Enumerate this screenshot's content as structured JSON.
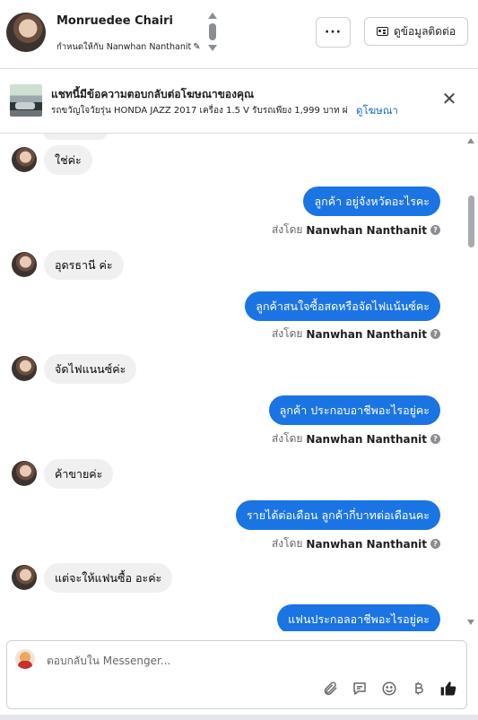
{
  "header": {
    "name": "Monruedee Chairi",
    "assigned_label": "กำหนดให้กับ Nanwhan Nanthanit",
    "more_label": "···",
    "contact_button": "ดูข้อมูลติดต่อ"
  },
  "ad_banner": {
    "title": "แชทนี้มีข้อความตอบกลับต่อโฆษณาของคุณ",
    "subtitle": "รถขวัญใจวัยรุ่น HONDA JAZZ 2017 เครื่อง 1.5 V รับรถเพียง 1,999 บาท ผ่...",
    "link": "ดูโฆษณา",
    "close": "✕"
  },
  "conversation": {
    "sent_by_prefix": "ส่งโดย",
    "agent_name": "Nanwhan Nanthanit",
    "messages": [
      {
        "dir": "in",
        "text": "ใช่ค่ะ"
      },
      {
        "dir": "out",
        "text": "ลูกค้า อยู่จังหวัดอะไรคะ"
      },
      {
        "dir": "in",
        "text": "อุดรธานี ค่ะ"
      },
      {
        "dir": "out",
        "text": "ลูกค้าสนใจซื้อสดหรือจัดไฟแน้นซ์คะ"
      },
      {
        "dir": "in",
        "text": "จัดไฟแนนซ์ค่ะ"
      },
      {
        "dir": "out",
        "text": "ลูกค้า ประกอบอาชีพอะไรอยู่คะ"
      },
      {
        "dir": "in",
        "text": "ค้าขายค่ะ"
      },
      {
        "dir": "out",
        "text": "รายได้ต่อเดือน ลูกค้ากี่บาทต่อเดือนคะ"
      },
      {
        "dir": "in",
        "text": "แต่จะให้แฟนซื้อ อะค่ะ"
      },
      {
        "dir": "out",
        "text": "แฟนประกอลอาชีพอะไรอยู่คะ"
      }
    ]
  },
  "composer": {
    "placeholder": "ตอบกลับใน Messenger..."
  },
  "icons": {
    "attach": "paperclip-icon",
    "saved_replies": "chat-bubble-icon",
    "emoji": "smiley-icon",
    "currency": "baht-icon",
    "like": "thumbs-up-icon"
  },
  "colors": {
    "accent": "#1b74e4",
    "incoming_bubble": "#f0f0f0",
    "link": "#1b66c9"
  }
}
